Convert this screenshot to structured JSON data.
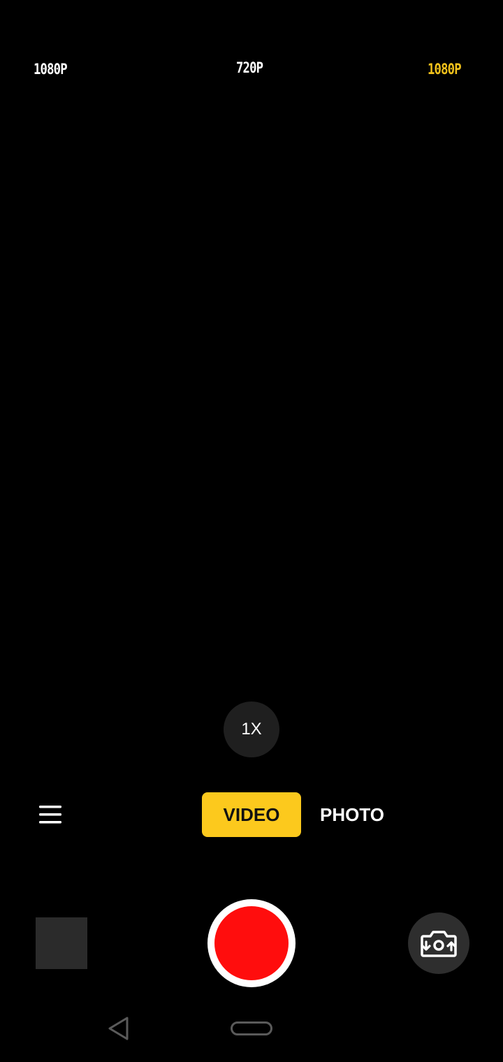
{
  "resolution_bar": {
    "left_label": "1080P",
    "center_label": "720P",
    "right_label": "1080P",
    "right_color": "#f2c21b"
  },
  "zoom": {
    "label": "1X"
  },
  "modes": {
    "video_label": "VIDEO",
    "photo_label": "PHOTO",
    "selected": "VIDEO",
    "accent_color": "#fcc91d"
  },
  "controls": {
    "menu_icon": "hamburger-menu-icon",
    "gallery_icon": "gallery-thumbnail",
    "shutter_color": "#ff0d0d",
    "switch_icon": "camera-switch-icon"
  },
  "navigation": {
    "back_icon": "back-triangle-icon",
    "home_icon": "home-pill-icon"
  }
}
